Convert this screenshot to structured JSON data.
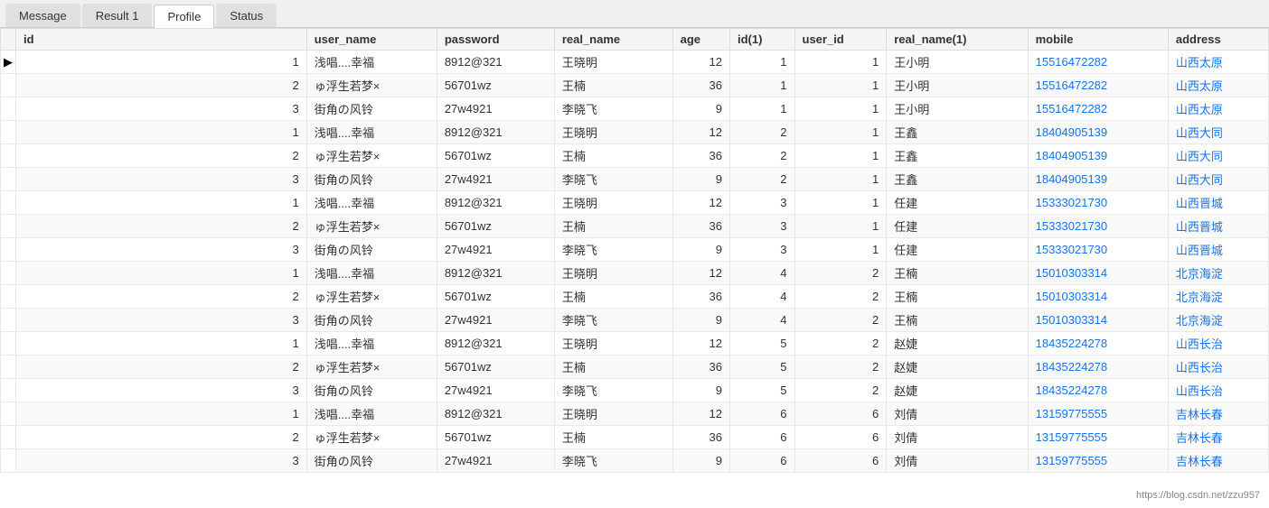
{
  "tabs": [
    {
      "label": "Message",
      "active": false
    },
    {
      "label": "Result 1",
      "active": false
    },
    {
      "label": "Profile",
      "active": true
    },
    {
      "label": "Status",
      "active": false
    }
  ],
  "columns": [
    "id",
    "user_name",
    "password",
    "real_name",
    "age",
    "id(1)",
    "user_id",
    "real_name(1)",
    "mobile",
    "address"
  ],
  "rows": [
    {
      "indicator": "▶",
      "id": "1",
      "user_name": "浅唱....幸福",
      "password": "8912@321",
      "real_name": "王晓明",
      "age": "12",
      "id1": "1",
      "user_id": "1",
      "real_name1": "王小明",
      "mobile": "15516472282",
      "address": "山西太原"
    },
    {
      "indicator": "",
      "id": "2",
      "user_name": "ゅ浮生若梦×",
      "password": "56701wz",
      "real_name": "王楠",
      "age": "36",
      "id1": "1",
      "user_id": "1",
      "real_name1": "王小明",
      "mobile": "15516472282",
      "address": "山西太原"
    },
    {
      "indicator": "",
      "id": "3",
      "user_name": "街角の风铃",
      "password": "27w4921",
      "real_name": "李晓飞",
      "age": "9",
      "id1": "1",
      "user_id": "1",
      "real_name1": "王小明",
      "mobile": "15516472282",
      "address": "山西太原"
    },
    {
      "indicator": "",
      "id": "1",
      "user_name": "浅唱....幸福",
      "password": "8912@321",
      "real_name": "王晓明",
      "age": "12",
      "id1": "2",
      "user_id": "1",
      "real_name1": "王鑫",
      "mobile": "18404905139",
      "address": "山西大同"
    },
    {
      "indicator": "",
      "id": "2",
      "user_name": "ゅ浮生若梦×",
      "password": "56701wz",
      "real_name": "王楠",
      "age": "36",
      "id1": "2",
      "user_id": "1",
      "real_name1": "王鑫",
      "mobile": "18404905139",
      "address": "山西大同"
    },
    {
      "indicator": "",
      "id": "3",
      "user_name": "街角の风铃",
      "password": "27w4921",
      "real_name": "李晓飞",
      "age": "9",
      "id1": "2",
      "user_id": "1",
      "real_name1": "王鑫",
      "mobile": "18404905139",
      "address": "山西大同"
    },
    {
      "indicator": "",
      "id": "1",
      "user_name": "浅唱....幸福",
      "password": "8912@321",
      "real_name": "王晓明",
      "age": "12",
      "id1": "3",
      "user_id": "1",
      "real_name1": "任建",
      "mobile": "15333021730",
      "address": "山西晋城"
    },
    {
      "indicator": "",
      "id": "2",
      "user_name": "ゅ浮生若梦×",
      "password": "56701wz",
      "real_name": "王楠",
      "age": "36",
      "id1": "3",
      "user_id": "1",
      "real_name1": "任建",
      "mobile": "15333021730",
      "address": "山西晋城"
    },
    {
      "indicator": "",
      "id": "3",
      "user_name": "街角の风铃",
      "password": "27w4921",
      "real_name": "李晓飞",
      "age": "9",
      "id1": "3",
      "user_id": "1",
      "real_name1": "任建",
      "mobile": "15333021730",
      "address": "山西晋城"
    },
    {
      "indicator": "",
      "id": "1",
      "user_name": "浅唱....幸福",
      "password": "8912@321",
      "real_name": "王晓明",
      "age": "12",
      "id1": "4",
      "user_id": "2",
      "real_name1": "王楠",
      "mobile": "15010303314",
      "address": "北京海淀"
    },
    {
      "indicator": "",
      "id": "2",
      "user_name": "ゅ浮生若梦×",
      "password": "56701wz",
      "real_name": "王楠",
      "age": "36",
      "id1": "4",
      "user_id": "2",
      "real_name1": "王楠",
      "mobile": "15010303314",
      "address": "北京海淀"
    },
    {
      "indicator": "",
      "id": "3",
      "user_name": "街角の风铃",
      "password": "27w4921",
      "real_name": "李晓飞",
      "age": "9",
      "id1": "4",
      "user_id": "2",
      "real_name1": "王楠",
      "mobile": "15010303314",
      "address": "北京海淀"
    },
    {
      "indicator": "",
      "id": "1",
      "user_name": "浅唱....幸福",
      "password": "8912@321",
      "real_name": "王晓明",
      "age": "12",
      "id1": "5",
      "user_id": "2",
      "real_name1": "赵婕",
      "mobile": "18435224278",
      "address": "山西长治"
    },
    {
      "indicator": "",
      "id": "2",
      "user_name": "ゅ浮生若梦×",
      "password": "56701wz",
      "real_name": "王楠",
      "age": "36",
      "id1": "5",
      "user_id": "2",
      "real_name1": "赵婕",
      "mobile": "18435224278",
      "address": "山西长治"
    },
    {
      "indicator": "",
      "id": "3",
      "user_name": "街角の风铃",
      "password": "27w4921",
      "real_name": "李晓飞",
      "age": "9",
      "id1": "5",
      "user_id": "2",
      "real_name1": "赵婕",
      "mobile": "18435224278",
      "address": "山西长治"
    },
    {
      "indicator": "",
      "id": "1",
      "user_name": "浅唱....幸福",
      "password": "8912@321",
      "real_name": "王晓明",
      "age": "12",
      "id1": "6",
      "user_id": "6",
      "real_name1": "刘倩",
      "mobile": "13159775555",
      "address": "吉林长春"
    },
    {
      "indicator": "",
      "id": "2",
      "user_name": "ゅ浮生若梦×",
      "password": "56701wz",
      "real_name": "王楠",
      "age": "36",
      "id1": "6",
      "user_id": "6",
      "real_name1": "刘倩",
      "mobile": "13159775555",
      "address": "吉林长春"
    },
    {
      "indicator": "",
      "id": "3",
      "user_name": "街角の风铃",
      "password": "27w4921",
      "real_name": "李晓飞",
      "age": "9",
      "id1": "6",
      "user_id": "6",
      "real_name1": "刘倩",
      "mobile": "13159775555",
      "address": "吉林长春"
    }
  ],
  "watermark": "https://blog.csdn.net/zzu957"
}
